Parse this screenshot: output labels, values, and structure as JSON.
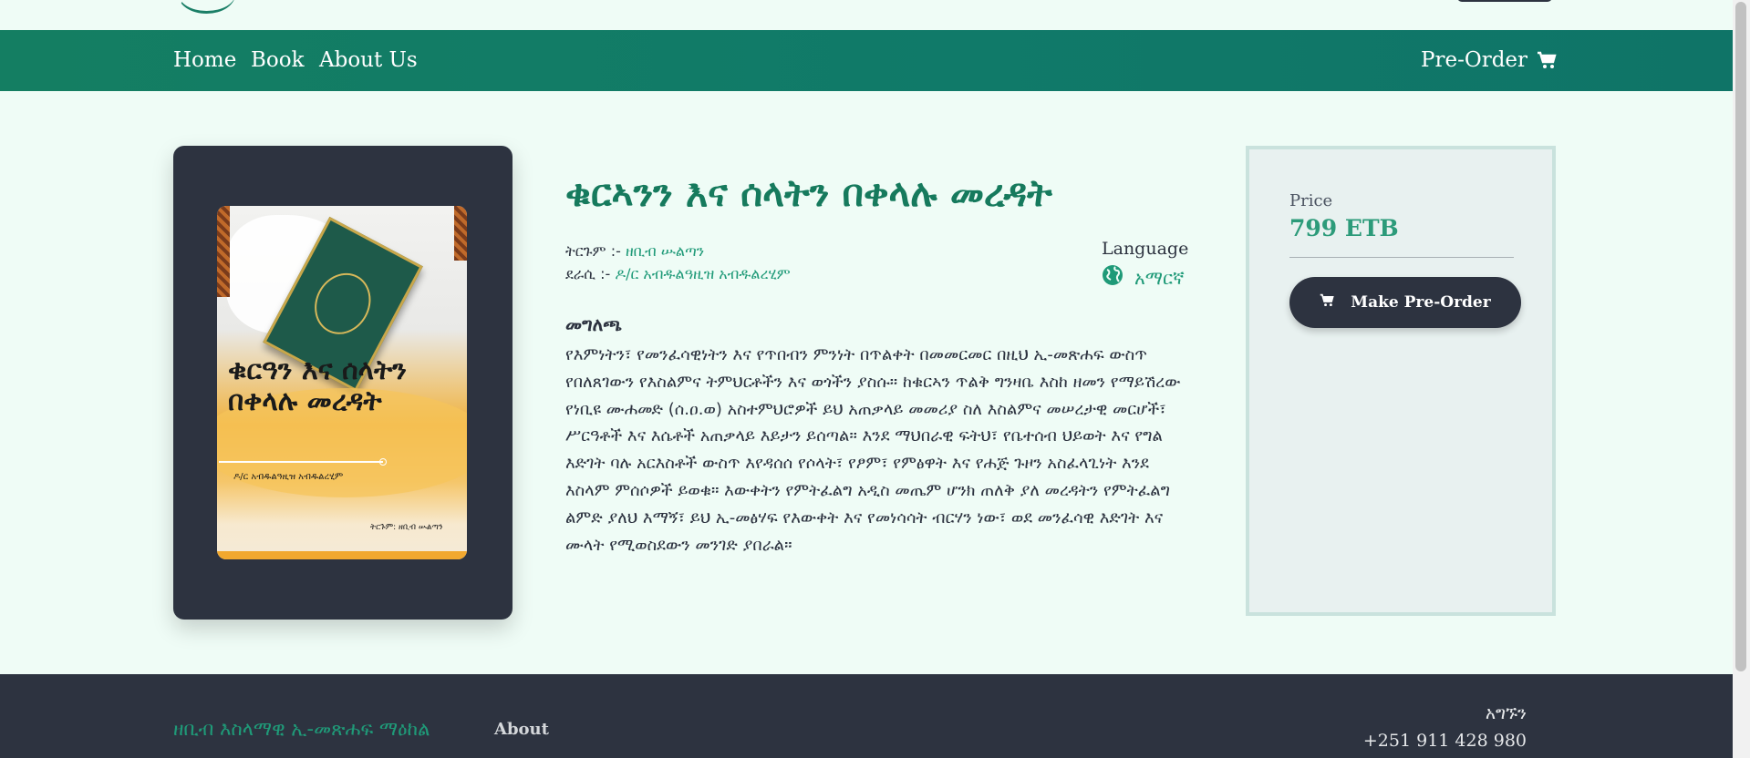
{
  "nav": {
    "links": [
      "Home",
      "Book",
      "About Us"
    ],
    "preorder_label": "Pre-Order",
    "preorder_icon": "cart-icon"
  },
  "book": {
    "title": "ቁርኣንን እና ሰላትን በቀላሉ መረዳት",
    "translator_label": "ትርጉም :-",
    "translator": "ዘቢብ ሡልጣን",
    "author_label": "ደራሲ :-",
    "author": "ዶ/ር አብዱልዓዚዝ አብዱልረሂም",
    "language_label": "Language",
    "language": "አማርኛ",
    "language_icon": "globe-icon",
    "description_heading": "መግለጫ",
    "description": "የእምነትን፣ የመንፈሳዊነትን እና የጥበብን ምንነት በጥልቀት በመመርመር በዚህ ኢ-መጽሐፍ ውስጥ የበለጸገውን የእስልምና ትምህርቶችን እና ወጎችን ያስሱ። ከቁርኣን ጥልቅ ግንዛቤ እስከ ዘመን የማይሽረው የነቢዩ ሙሐመድ (ሰ.ዐ.ወ) አስተምህሮዎች ይህ አጠቃላይ መመሪያ ስለ እስልምና መሠረታዊ መርሆች፣ ሥርዓቶች እና እሴቶች አጠቃላይ እይታን ይሰጣል። እንደ ማህበራዊ ፍትህ፣ የቤተሰብ ህይወት እና የግል እድገት ባሉ አርእስቶች ውስጥ እየዳሰሰ የሶላት፣ የፆም፣ የምፅዋት እና የሐጅ ጉዞን አስፈላጊነት እንደ እስላም ምሰሶዎች ይወቁ። እውቀትን የምትፈልግ አዲስ መጤም ሆንክ ጠለቅ ያለ መረዳትን የምትፈልግ ልምድ ያለህ እማኝ፣ ይህ ኢ-መፅሃፍ የእውቀት እና የመነሳሳት ብርሃን ነው፣ ወደ መንፈሳዊ እድገት እና ሙላት የሚወስደውን መንገድ ያበራል።"
  },
  "cover": {
    "title": "ቁርዓን እና ሰላትን በቀላሉ መረዳት",
    "author": "ዶ/ር አብዱልዓዚዝ አብዱልረሂም",
    "translator": "ትርጉም: ዘቢብ ሡልጣን"
  },
  "purchase": {
    "price_label": "Price",
    "price": "799 ETB",
    "button_label": "Make Pre-Order",
    "button_icon": "cart-icon"
  },
  "footer": {
    "brand": "ዘቢብ እስላማዊ ኢ-መጽሐፍ ማዕከል",
    "about": "About",
    "contact_label": "አግኙን",
    "phone": "+251 911 428 980"
  },
  "colors": {
    "accent": "#167a5d",
    "nav": "#147e62",
    "dark": "#2d3340",
    "background": "#effcf6"
  }
}
